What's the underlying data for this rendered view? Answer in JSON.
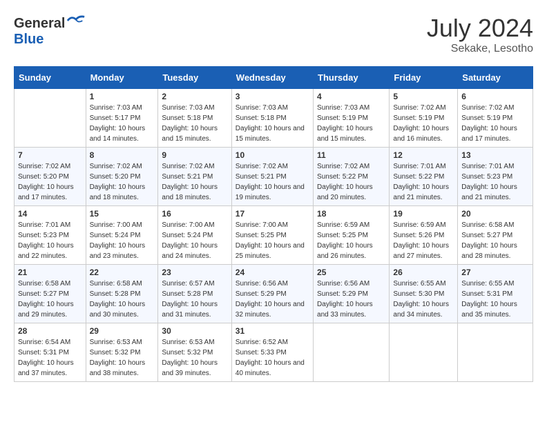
{
  "header": {
    "logo_general": "General",
    "logo_blue": "Blue",
    "month_year": "July 2024",
    "location": "Sekake, Lesotho"
  },
  "days_of_week": [
    "Sunday",
    "Monday",
    "Tuesday",
    "Wednesday",
    "Thursday",
    "Friday",
    "Saturday"
  ],
  "weeks": [
    [
      {
        "day": "",
        "empty": true
      },
      {
        "day": "1",
        "sunrise": "Sunrise: 7:03 AM",
        "sunset": "Sunset: 5:17 PM",
        "daylight": "Daylight: 10 hours and 14 minutes."
      },
      {
        "day": "2",
        "sunrise": "Sunrise: 7:03 AM",
        "sunset": "Sunset: 5:18 PM",
        "daylight": "Daylight: 10 hours and 15 minutes."
      },
      {
        "day": "3",
        "sunrise": "Sunrise: 7:03 AM",
        "sunset": "Sunset: 5:18 PM",
        "daylight": "Daylight: 10 hours and 15 minutes."
      },
      {
        "day": "4",
        "sunrise": "Sunrise: 7:03 AM",
        "sunset": "Sunset: 5:19 PM",
        "daylight": "Daylight: 10 hours and 15 minutes."
      },
      {
        "day": "5",
        "sunrise": "Sunrise: 7:02 AM",
        "sunset": "Sunset: 5:19 PM",
        "daylight": "Daylight: 10 hours and 16 minutes."
      },
      {
        "day": "6",
        "sunrise": "Sunrise: 7:02 AM",
        "sunset": "Sunset: 5:19 PM",
        "daylight": "Daylight: 10 hours and 17 minutes."
      }
    ],
    [
      {
        "day": "7",
        "sunrise": "Sunrise: 7:02 AM",
        "sunset": "Sunset: 5:20 PM",
        "daylight": "Daylight: 10 hours and 17 minutes."
      },
      {
        "day": "8",
        "sunrise": "Sunrise: 7:02 AM",
        "sunset": "Sunset: 5:20 PM",
        "daylight": "Daylight: 10 hours and 18 minutes."
      },
      {
        "day": "9",
        "sunrise": "Sunrise: 7:02 AM",
        "sunset": "Sunset: 5:21 PM",
        "daylight": "Daylight: 10 hours and 18 minutes."
      },
      {
        "day": "10",
        "sunrise": "Sunrise: 7:02 AM",
        "sunset": "Sunset: 5:21 PM",
        "daylight": "Daylight: 10 hours and 19 minutes."
      },
      {
        "day": "11",
        "sunrise": "Sunrise: 7:02 AM",
        "sunset": "Sunset: 5:22 PM",
        "daylight": "Daylight: 10 hours and 20 minutes."
      },
      {
        "day": "12",
        "sunrise": "Sunrise: 7:01 AM",
        "sunset": "Sunset: 5:22 PM",
        "daylight": "Daylight: 10 hours and 21 minutes."
      },
      {
        "day": "13",
        "sunrise": "Sunrise: 7:01 AM",
        "sunset": "Sunset: 5:23 PM",
        "daylight": "Daylight: 10 hours and 21 minutes."
      }
    ],
    [
      {
        "day": "14",
        "sunrise": "Sunrise: 7:01 AM",
        "sunset": "Sunset: 5:23 PM",
        "daylight": "Daylight: 10 hours and 22 minutes."
      },
      {
        "day": "15",
        "sunrise": "Sunrise: 7:00 AM",
        "sunset": "Sunset: 5:24 PM",
        "daylight": "Daylight: 10 hours and 23 minutes."
      },
      {
        "day": "16",
        "sunrise": "Sunrise: 7:00 AM",
        "sunset": "Sunset: 5:24 PM",
        "daylight": "Daylight: 10 hours and 24 minutes."
      },
      {
        "day": "17",
        "sunrise": "Sunrise: 7:00 AM",
        "sunset": "Sunset: 5:25 PM",
        "daylight": "Daylight: 10 hours and 25 minutes."
      },
      {
        "day": "18",
        "sunrise": "Sunrise: 6:59 AM",
        "sunset": "Sunset: 5:25 PM",
        "daylight": "Daylight: 10 hours and 26 minutes."
      },
      {
        "day": "19",
        "sunrise": "Sunrise: 6:59 AM",
        "sunset": "Sunset: 5:26 PM",
        "daylight": "Daylight: 10 hours and 27 minutes."
      },
      {
        "day": "20",
        "sunrise": "Sunrise: 6:58 AM",
        "sunset": "Sunset: 5:27 PM",
        "daylight": "Daylight: 10 hours and 28 minutes."
      }
    ],
    [
      {
        "day": "21",
        "sunrise": "Sunrise: 6:58 AM",
        "sunset": "Sunset: 5:27 PM",
        "daylight": "Daylight: 10 hours and 29 minutes."
      },
      {
        "day": "22",
        "sunrise": "Sunrise: 6:58 AM",
        "sunset": "Sunset: 5:28 PM",
        "daylight": "Daylight: 10 hours and 30 minutes."
      },
      {
        "day": "23",
        "sunrise": "Sunrise: 6:57 AM",
        "sunset": "Sunset: 5:28 PM",
        "daylight": "Daylight: 10 hours and 31 minutes."
      },
      {
        "day": "24",
        "sunrise": "Sunrise: 6:56 AM",
        "sunset": "Sunset: 5:29 PM",
        "daylight": "Daylight: 10 hours and 32 minutes."
      },
      {
        "day": "25",
        "sunrise": "Sunrise: 6:56 AM",
        "sunset": "Sunset: 5:29 PM",
        "daylight": "Daylight: 10 hours and 33 minutes."
      },
      {
        "day": "26",
        "sunrise": "Sunrise: 6:55 AM",
        "sunset": "Sunset: 5:30 PM",
        "daylight": "Daylight: 10 hours and 34 minutes."
      },
      {
        "day": "27",
        "sunrise": "Sunrise: 6:55 AM",
        "sunset": "Sunset: 5:31 PM",
        "daylight": "Daylight: 10 hours and 35 minutes."
      }
    ],
    [
      {
        "day": "28",
        "sunrise": "Sunrise: 6:54 AM",
        "sunset": "Sunset: 5:31 PM",
        "daylight": "Daylight: 10 hours and 37 minutes."
      },
      {
        "day": "29",
        "sunrise": "Sunrise: 6:53 AM",
        "sunset": "Sunset: 5:32 PM",
        "daylight": "Daylight: 10 hours and 38 minutes."
      },
      {
        "day": "30",
        "sunrise": "Sunrise: 6:53 AM",
        "sunset": "Sunset: 5:32 PM",
        "daylight": "Daylight: 10 hours and 39 minutes."
      },
      {
        "day": "31",
        "sunrise": "Sunrise: 6:52 AM",
        "sunset": "Sunset: 5:33 PM",
        "daylight": "Daylight: 10 hours and 40 minutes."
      },
      {
        "day": "",
        "empty": true
      },
      {
        "day": "",
        "empty": true
      },
      {
        "day": "",
        "empty": true
      }
    ]
  ]
}
